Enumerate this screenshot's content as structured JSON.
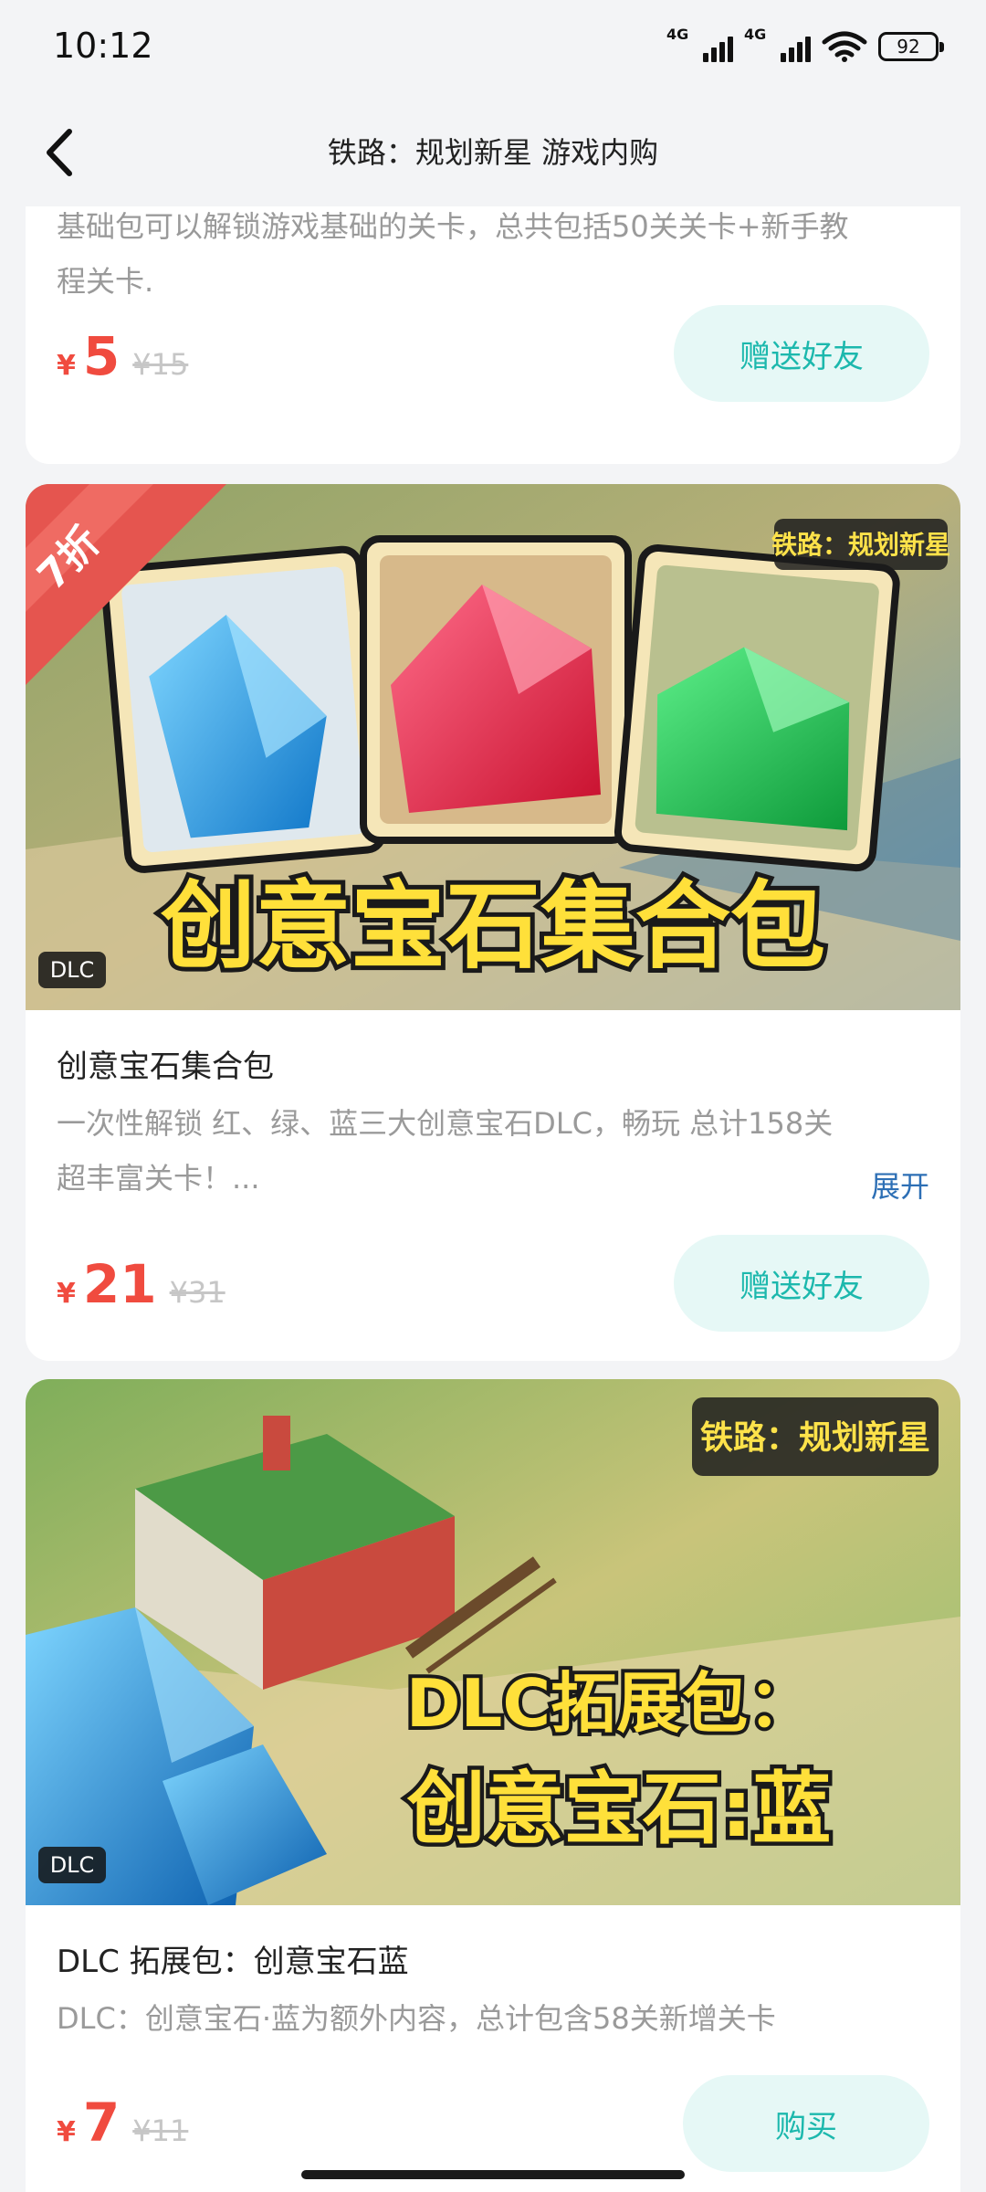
{
  "status": {
    "time": "10:12",
    "network1": "4G",
    "network2": "4G",
    "battery": "92"
  },
  "nav": {
    "title": "铁路：规划新星 游戏内购"
  },
  "items": [
    {
      "desc_line1": "基础包可以解锁游戏基础的关卡，总共包括50关关卡+新手教",
      "desc_line2": "程关卡.",
      "currency": "¥",
      "price": "5",
      "original_price": "¥15",
      "button": "赠送好友"
    },
    {
      "badge_discount": "7折",
      "badge_type": "DLC",
      "banner_logo": "铁路：规划新星",
      "banner_text": "创意宝石集合包",
      "title": "创意宝石集合包",
      "desc_line1": "一次性解锁 红、绿、蓝三大创意宝石DLC，畅玩 总计158关",
      "desc_line2": "超丰富关卡！...",
      "expand": "展开",
      "currency": "¥",
      "price": "21",
      "original_price": "¥31",
      "button": "赠送好友"
    },
    {
      "badge_type": "DLC",
      "banner_logo": "铁路：规划新星",
      "banner_text1": "DLC拓展包：",
      "banner_text2": "创意宝石:蓝",
      "title": "DLC 拓展包：创意宝石蓝",
      "desc_line1": "DLC：创意宝石·蓝为额外内容，总计包含58关新增关卡",
      "currency": "¥",
      "price": "7",
      "original_price": "¥11",
      "button": "购买"
    }
  ],
  "colors": {
    "price": "#f04b3f",
    "button_bg": "#e6f8f6",
    "button_text": "#1cb8ad",
    "link": "#2d6fb5"
  }
}
